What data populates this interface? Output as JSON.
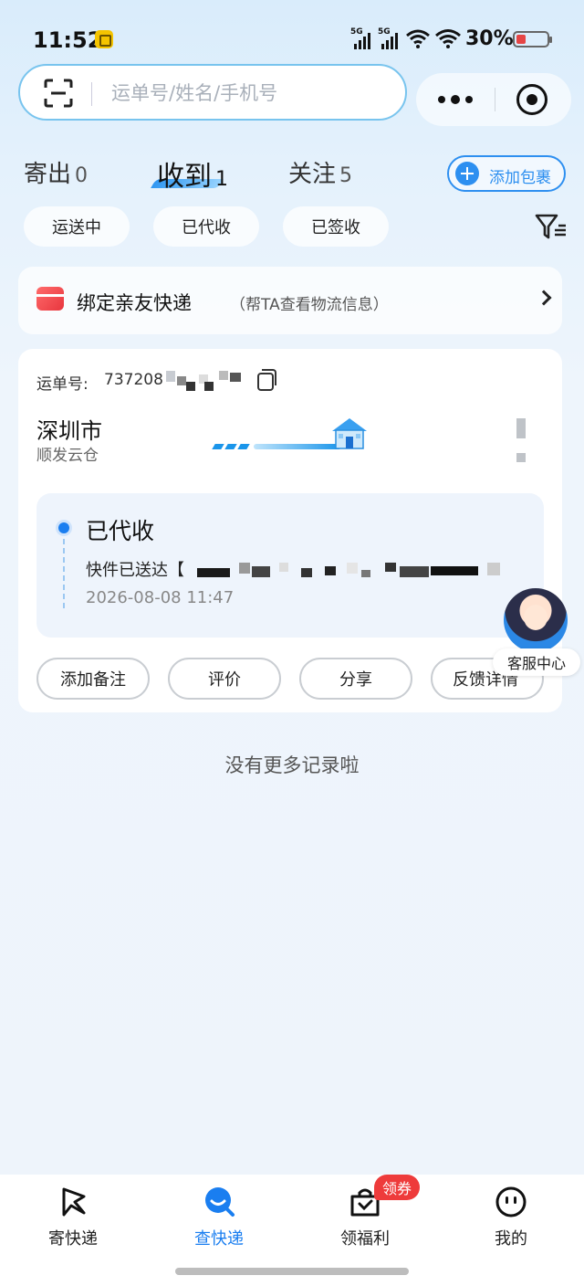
{
  "status_bar": {
    "time": "11:52",
    "signal_1": "5G",
    "signal_2": "5G",
    "battery": "30%"
  },
  "search": {
    "placeholder": "运单号/姓名/手机号",
    "icons": [
      "scan-icon",
      "more-icon",
      "target-icon"
    ]
  },
  "tabs": [
    {
      "label": "寄出",
      "count": "0"
    },
    {
      "label": "收到",
      "count": "1"
    },
    {
      "label": "关注",
      "count": "5"
    }
  ],
  "add_package": "添加包裹",
  "filters": [
    "运送中",
    "已代收",
    "已签收"
  ],
  "bind_card": {
    "title": "绑定亲友快递",
    "subtitle": "（帮TA查看物流信息）"
  },
  "package": {
    "waybill_label": "运单号:",
    "waybill_number": "737208",
    "from_city": "深圳市",
    "from_station": "顺发云仓",
    "status_title": "已代收",
    "status_desc": "快件已送达【",
    "status_time": "2026-08-08 11:47",
    "buttons": [
      "添加备注",
      "评价",
      "分享",
      "反馈详情"
    ]
  },
  "customer_service": "客服中心",
  "no_more": "没有更多记录啦",
  "nav": {
    "items": [
      "寄快递",
      "查快递",
      "领福利",
      "我的"
    ],
    "coupon_badge": "领券"
  },
  "colors": {
    "accent": "#1a7ef0",
    "badge_red": "#ee3b3b",
    "route_blue": "#1a95ea"
  }
}
